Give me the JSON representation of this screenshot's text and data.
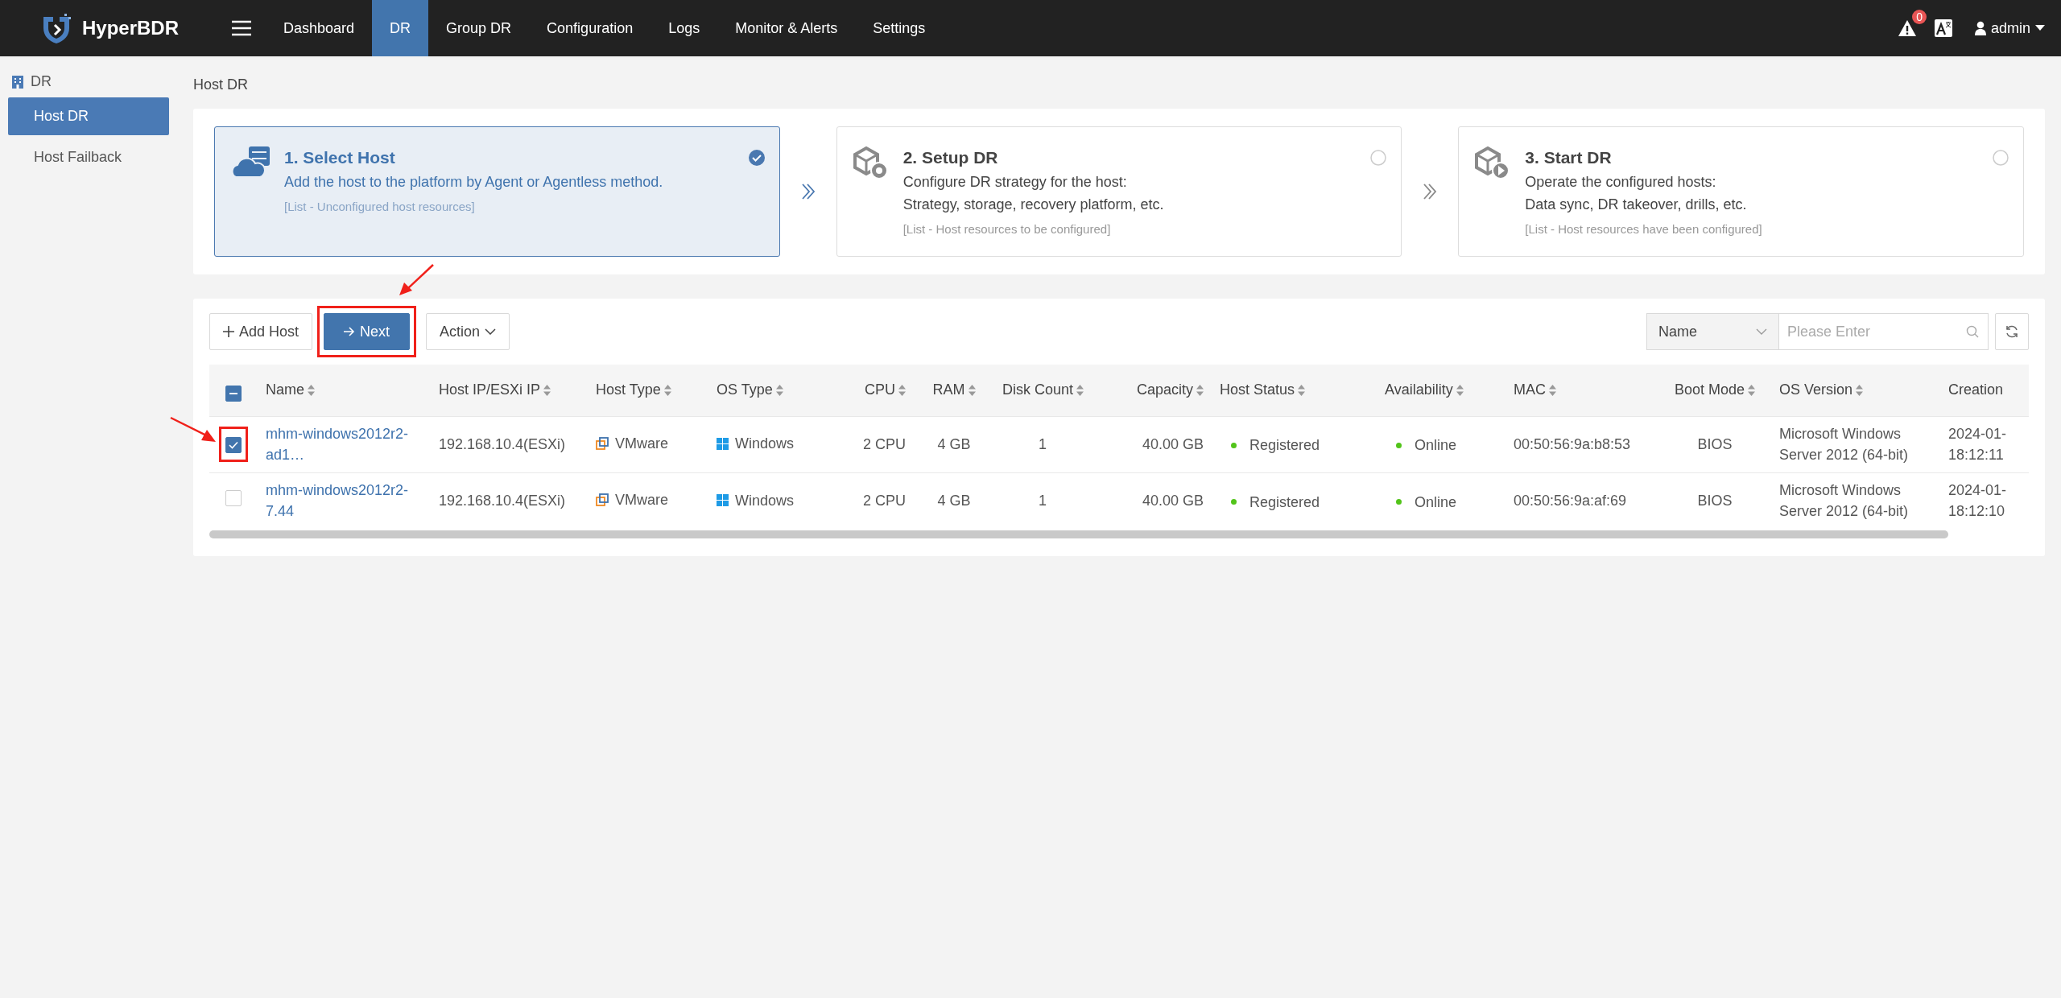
{
  "app": {
    "name": "HyperBDR"
  },
  "nav": {
    "items": [
      {
        "label": "Dashboard",
        "selected": false
      },
      {
        "label": "DR",
        "selected": true
      },
      {
        "label": "Group DR",
        "selected": false
      },
      {
        "label": "Configuration",
        "selected": false
      },
      {
        "label": "Logs",
        "selected": false
      },
      {
        "label": "Monitor & Alerts",
        "selected": false
      },
      {
        "label": "Settings",
        "selected": false
      }
    ],
    "alert_count": "0",
    "user": "admin"
  },
  "sidebar": {
    "section": "DR",
    "items": [
      {
        "label": "Host DR",
        "selected": true
      },
      {
        "label": "Host Failback",
        "selected": false
      }
    ]
  },
  "page_title": "Host DR",
  "steps": [
    {
      "kind": "host",
      "title": "1. Select Host",
      "lines": [
        "Add the host to the platform by Agent or Agentless method."
      ],
      "note": "[List - Unconfigured host resources]",
      "selected": true
    },
    {
      "kind": "setup",
      "title": "2. Setup DR",
      "lines": [
        "Configure DR strategy for the host:",
        "Strategy, storage, recovery platform, etc."
      ],
      "note": "[List - Host resources to be configured]",
      "selected": false
    },
    {
      "kind": "start",
      "title": "3. Start DR",
      "lines": [
        "Operate the configured hosts:",
        "Data sync, DR takeover, drills, etc."
      ],
      "note": "[List - Host resources have been configured]",
      "selected": false
    }
  ],
  "toolbar": {
    "buttons": [
      {
        "kind": "add",
        "label": "Add Host",
        "highlighted": false
      },
      {
        "kind": "next",
        "label": "Next",
        "highlighted": true
      },
      {
        "kind": "action",
        "label": "Action",
        "highlighted": false
      }
    ],
    "filter": {
      "field": "Name",
      "placeholder": "Please Enter"
    }
  },
  "table": {
    "select_all_partial": true,
    "columns": [
      "Name",
      "Host IP/ESXi IP",
      "Host Type",
      "OS Type",
      "CPU",
      "RAM",
      "Disk Count",
      "Capacity",
      "Host Status",
      "Availability",
      "MAC",
      "Boot Mode",
      "OS Version",
      "Creation"
    ],
    "rows": [
      {
        "selected": true,
        "highlighted": true,
        "cells": [
          {
            "kind": "link",
            "text": "mhm-windows2012r2-ad1…"
          },
          {
            "kind": "text",
            "text": "192.168.10.4(ESXi)"
          },
          {
            "kind": "vmware",
            "text": "VMware"
          },
          {
            "kind": "windows",
            "text": "Windows"
          },
          {
            "kind": "text",
            "text": "2 CPU"
          },
          {
            "kind": "text",
            "text": "4 GB"
          },
          {
            "kind": "text",
            "text": "1"
          },
          {
            "kind": "text",
            "text": "40.00 GB"
          },
          {
            "kind": "status",
            "text": "Registered",
            "color": "#52c41a"
          },
          {
            "kind": "status",
            "text": "Online",
            "color": "#52c41a"
          },
          {
            "kind": "text",
            "text": "00:50:56:9a:b8:53"
          },
          {
            "kind": "text",
            "text": "BIOS"
          },
          {
            "kind": "text",
            "text": "Microsoft Windows Server 2012 (64-bit)"
          },
          {
            "kind": "text",
            "text": "2024-01- 18:12:11"
          }
        ]
      },
      {
        "selected": false,
        "highlighted": false,
        "cells": [
          {
            "kind": "link",
            "text": "mhm-windows2012r2-7.44"
          },
          {
            "kind": "text",
            "text": "192.168.10.4(ESXi)"
          },
          {
            "kind": "vmware",
            "text": "VMware"
          },
          {
            "kind": "windows",
            "text": "Windows"
          },
          {
            "kind": "text",
            "text": "2 CPU"
          },
          {
            "kind": "text",
            "text": "4 GB"
          },
          {
            "kind": "text",
            "text": "1"
          },
          {
            "kind": "text",
            "text": "40.00 GB"
          },
          {
            "kind": "status",
            "text": "Registered",
            "color": "#52c41a"
          },
          {
            "kind": "status",
            "text": "Online",
            "color": "#52c41a"
          },
          {
            "kind": "text",
            "text": "00:50:56:9a:af:69"
          },
          {
            "kind": "text",
            "text": "BIOS"
          },
          {
            "kind": "text",
            "text": "Microsoft Windows Server 2012 (64-bit)"
          },
          {
            "kind": "text",
            "text": "2024-01- 18:12:10"
          }
        ]
      }
    ]
  }
}
